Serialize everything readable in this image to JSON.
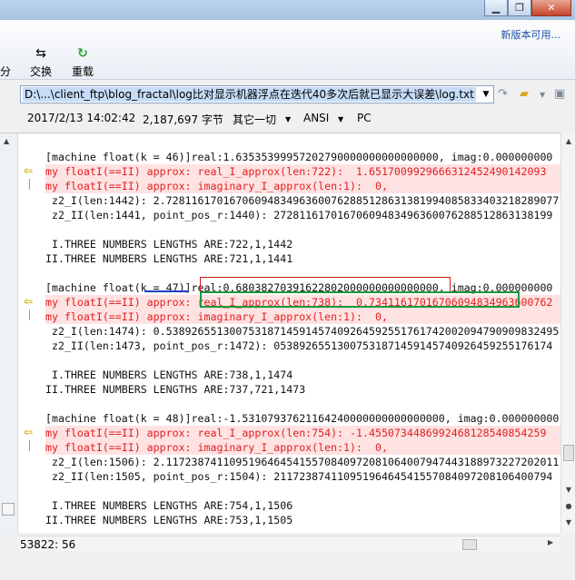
{
  "window": {
    "minimize_glyph": "▁",
    "maximize_glyph": "❐",
    "close_glyph": "✕"
  },
  "toolbar": {
    "new_version_link": "新版本可用...",
    "left_partial_label": "分",
    "exchange_label": "交换",
    "exchange_icon": "⇆",
    "reload_label": "重载",
    "reload_icon": "↻",
    "icon_colors": {
      "reload": "#2aa52a"
    }
  },
  "pathbar": {
    "path": "D:\\...\\client_ftp\\blog_fractal\\log比对显示机器浮点在迭代40多次后就已显示大误差\\log.txt",
    "dropdown_glyph": "▼"
  },
  "info": {
    "datetime": "2017/2/13 14:02:42",
    "size": "2,187,697 字节",
    "other": "其它一切",
    "encoding": "ANSI",
    "line_ending": "PC",
    "dropdown_glyph": "▼"
  },
  "lines": [
    {
      "text": "",
      "red": false
    },
    {
      "text": "[machine float(k = 46)]real:1.63535399957202790000000000000000, imag:0.000000000",
      "red": false
    },
    {
      "text": "my floatI(==II) approx: real_I_approx(len:722):  1.6517009929666312452490142093",
      "red": true
    },
    {
      "text": "my floatI(==II) approx: imaginary_I_approx(len:1):  0,",
      "red": true
    },
    {
      "text": " z2_I(len:1442): 2.72811617016706094834963600762885128631381994085833403218289077",
      "red": false
    },
    {
      "text": " z2_II(len:1441, point_pos_r:1440): 27281161701670609483496360076288512863138199",
      "red": false
    },
    {
      "text": "",
      "red": false
    },
    {
      "text": " I.THREE NUMBERS LENGTHS ARE:722,1,1442",
      "red": false
    },
    {
      "text": "II.THREE NUMBERS LENGTHS ARE:721,1,1441",
      "red": false
    },
    {
      "text": "",
      "red": false
    },
    {
      "text": "[machine float(k = 47)]real:0.68038270391622802000000000000000, imag:0.000000000",
      "red": false
    },
    {
      "text": "my floatI(==II) approx: real_I_approx(len:738):  0.73411617016706094834963600762",
      "red": true
    },
    {
      "text": "my floatI(==II) approx: imaginary_I_approx(len:1):  0,",
      "red": true
    },
    {
      "text": " z2_I(len:1474): 0.53892655130075318714591457409264592551761742002094790909832495",
      "red": false
    },
    {
      "text": " z2_II(len:1473, point_pos_r:1472): 05389265513007531871459145740926459255176174",
      "red": false
    },
    {
      "text": "",
      "red": false
    },
    {
      "text": " I.THREE NUMBERS LENGTHS ARE:738,1,1474",
      "red": false
    },
    {
      "text": "II.THREE NUMBERS LENGTHS ARE:737,721,1473",
      "red": false
    },
    {
      "text": "",
      "red": false
    },
    {
      "text": "[machine float(k = 48)]real:-1.53107937621164240000000000000000, imag:0.000000000",
      "red": false
    },
    {
      "text": "my floatI(==II) approx: real_I_approx(len:754): -1.4550734486992468128540854259",
      "red": true
    },
    {
      "text": "my floatI(==II) approx: imaginary_I_approx(len:1):  0,",
      "red": true
    },
    {
      "text": " z2_I(len:1506): 2.11723874110951964645415570840972081064007947443188973227202011",
      "red": false
    },
    {
      "text": " z2_II(len:1505, point_pos_r:1504): 21172387411095196464541557084097208106400794",
      "red": false
    },
    {
      "text": "",
      "red": false
    },
    {
      "text": " I.THREE NUMBERS LENGTHS ARE:754,1,1506",
      "red": false
    },
    {
      "text": "II.THREE NUMBERS LENGTHS ARE:753,1,1505",
      "red": false
    }
  ],
  "gutter_arrow_glyph": "⇦",
  "status": {
    "position": "53822: 56"
  },
  "colors": {
    "diff_red_text": "#e12020",
    "diff_red_bg": "#ffe2e2",
    "box_red": "#d01818",
    "box_green": "#1c9a3a",
    "underline_blue": "#1f3fc2",
    "path_highlight": "#c6dcf7",
    "link_blue": "#1b4fa8"
  }
}
